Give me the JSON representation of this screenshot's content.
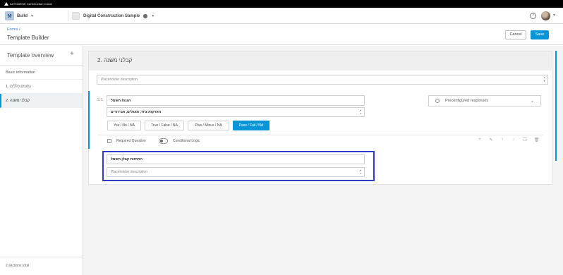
{
  "brand": {
    "text": "AUTODESK Construction Cloud"
  },
  "topbar": {
    "app_name": "Build",
    "project_name": "Digital Construction Sample",
    "icons": [
      "build-logo-icon",
      "project-thumbnail-icon",
      "globe-icon",
      "help-icon",
      "avatar"
    ]
  },
  "header": {
    "breadcrumb": "Forms /",
    "title": "Template Builder",
    "cancel_label": "Cancel",
    "save_label": "Save"
  },
  "sidebar": {
    "title": "Template overview",
    "add_symbol": "+",
    "items": [
      {
        "label": "Basic information",
        "active": false
      },
      {
        "label": "1. נתונים כללים",
        "active": false
      },
      {
        "label": "2. קבלני משנה",
        "active": true
      }
    ],
    "footer": "2 sections total"
  },
  "section": {
    "title": "2. קבלני משנה",
    "description_placeholder": "Placeholder description"
  },
  "question": {
    "number": "2.1",
    "text": "הגנות חשמל",
    "dropdown_value": "הארקות ציוד, מעגלים, אבירורים",
    "responses_label": "Preconfigured responses",
    "options": [
      {
        "label": "Yes / No / NA",
        "selected": false
      },
      {
        "label": "True / False / NA",
        "selected": false
      },
      {
        "label": "Plus / Minus / NA",
        "selected": false
      },
      {
        "label": "Pass / Fail / NA",
        "selected": true
      }
    ],
    "required_label": "Required Question",
    "conditional_label": "Conditional Logic",
    "tool_icons": [
      "+",
      "✎",
      "↑",
      "↓",
      "❐",
      "🗑"
    ]
  },
  "next_item": {
    "title": "התחזות קבלן חשמל",
    "description_placeholder": "Placeholder description"
  },
  "colors": {
    "accent": "#0696d7",
    "highlight": "#2e3cc9"
  }
}
